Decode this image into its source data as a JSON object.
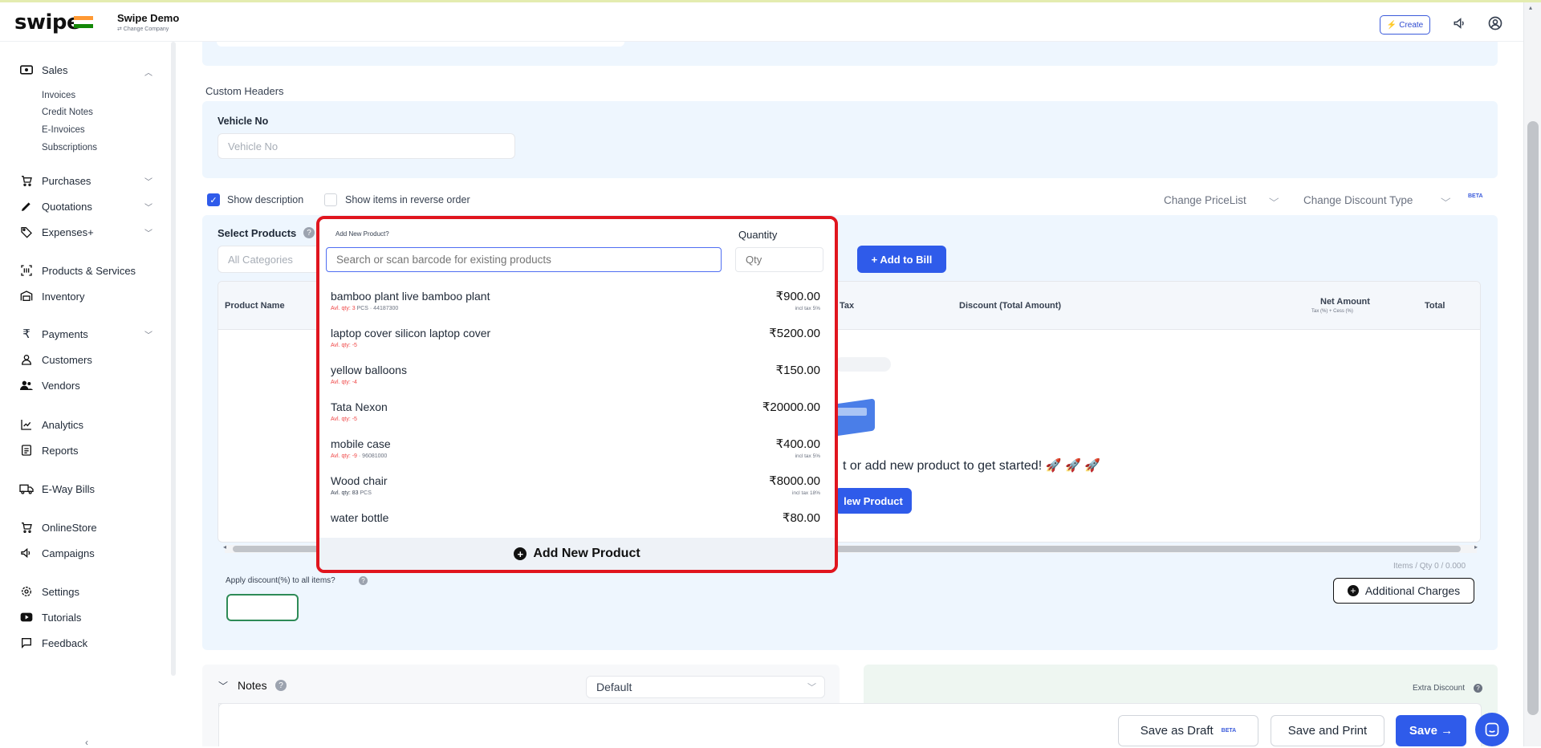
{
  "header": {
    "logo_text": "swipe",
    "company_name": "Swipe Demo",
    "change_company": "⇄ Change Company",
    "create_label": "Create"
  },
  "sidebar": {
    "sales": {
      "label": "Sales",
      "sub": [
        "Invoices",
        "Credit Notes",
        "E-Invoices",
        "Subscriptions"
      ]
    },
    "items": [
      {
        "label": "Purchases",
        "icon": "cart-icon"
      },
      {
        "label": "Quotations",
        "icon": "pen-icon"
      },
      {
        "label": "Expenses+",
        "icon": "tag-icon"
      },
      {
        "label": "Products & Services",
        "icon": "barcode-icon"
      },
      {
        "label": "Inventory",
        "icon": "warehouse-icon"
      },
      {
        "label": "Payments",
        "icon": "rupee-icon"
      },
      {
        "label": "Customers",
        "icon": "user-icon"
      },
      {
        "label": "Vendors",
        "icon": "users-icon"
      },
      {
        "label": "Analytics",
        "icon": "chart-icon"
      },
      {
        "label": "Reports",
        "icon": "report-icon"
      },
      {
        "label": "E-Way Bills",
        "icon": "truck-icon"
      },
      {
        "label": "OnlineStore",
        "icon": "store-icon"
      },
      {
        "label": "Campaigns",
        "icon": "megaphone-icon"
      },
      {
        "label": "Settings",
        "icon": "gear-icon"
      },
      {
        "label": "Tutorials",
        "icon": "youtube-icon"
      },
      {
        "label": "Feedback",
        "icon": "comment-icon"
      }
    ]
  },
  "form": {
    "custom_headers": "Custom Headers",
    "vehicle_label": "Vehicle No",
    "vehicle_placeholder": "Vehicle No",
    "show_description": "Show description",
    "show_reverse": "Show items in reverse order",
    "change_pricelist": "Change PriceList",
    "change_discount": "Change Discount Type",
    "beta": "BETA",
    "select_products": "Select Products",
    "all_categories": "All Categories",
    "add_new_product_q": "Add New Product?",
    "quantity_label": "Quantity",
    "search_placeholder": "Search or scan barcode for existing products",
    "qty_placeholder": "Qty",
    "add_to_bill": "+ Add to Bill",
    "table": {
      "product_name": "Product Name",
      "tax": "Tax",
      "discount": "Discount (Total Amount)",
      "net_amount": "Net Amount",
      "net_amount_sub": "Tax (%) + Cess (%)",
      "total": "Total"
    },
    "empty_text": "t or add new product to get started! 🚀 🚀 🚀",
    "new_product_btn": "lew Product",
    "items_qty": "Items / Qty 0 / 0.000",
    "apply_discount": "Apply discount(%) to all items?",
    "additional_charges": "Additional Charges",
    "notes": "Notes",
    "notes_default": "Default",
    "extra_discount": "Extra Discount"
  },
  "dropdown": {
    "items": [
      {
        "name": "bamboo plant live bamboo plant",
        "sub": "Avl. qty: 3",
        "extra": "PCS · 44187300",
        "price": "₹900.00",
        "tax": "incl tax 5%"
      },
      {
        "name": "laptop cover silicon laptop cover",
        "sub": "Avl. qty: -5",
        "extra": "",
        "price": "₹5200.00",
        "tax": ""
      },
      {
        "name": "yellow balloons",
        "sub": "Avl. qty: -4",
        "extra": "",
        "price": "₹150.00",
        "tax": ""
      },
      {
        "name": "Tata Nexon",
        "sub": "Avl. qty: -5",
        "extra": "",
        "price": "₹20000.00",
        "tax": ""
      },
      {
        "name": "mobile case",
        "sub": "Avl. qty: -9",
        "extra": "· 96081000",
        "price": "₹400.00",
        "tax": "incl tax 5%"
      },
      {
        "name": "Wood chair",
        "sub": "Avl. qty: 83",
        "extra": "PCS",
        "price": "₹8000.00",
        "tax": "incl tax 18%"
      },
      {
        "name": "water bottle",
        "sub": "",
        "extra": "",
        "price": "₹80.00",
        "tax": ""
      }
    ],
    "add_new_product": "Add New Product"
  },
  "footer": {
    "save_draft": "Save as Draft",
    "beta": "BETA",
    "save_print": "Save and Print",
    "save": "Save →"
  },
  "colors": {
    "brand_blue": "#2f5bea",
    "highlight_red": "#e0151e",
    "panel_bg": "#eef6fe"
  }
}
